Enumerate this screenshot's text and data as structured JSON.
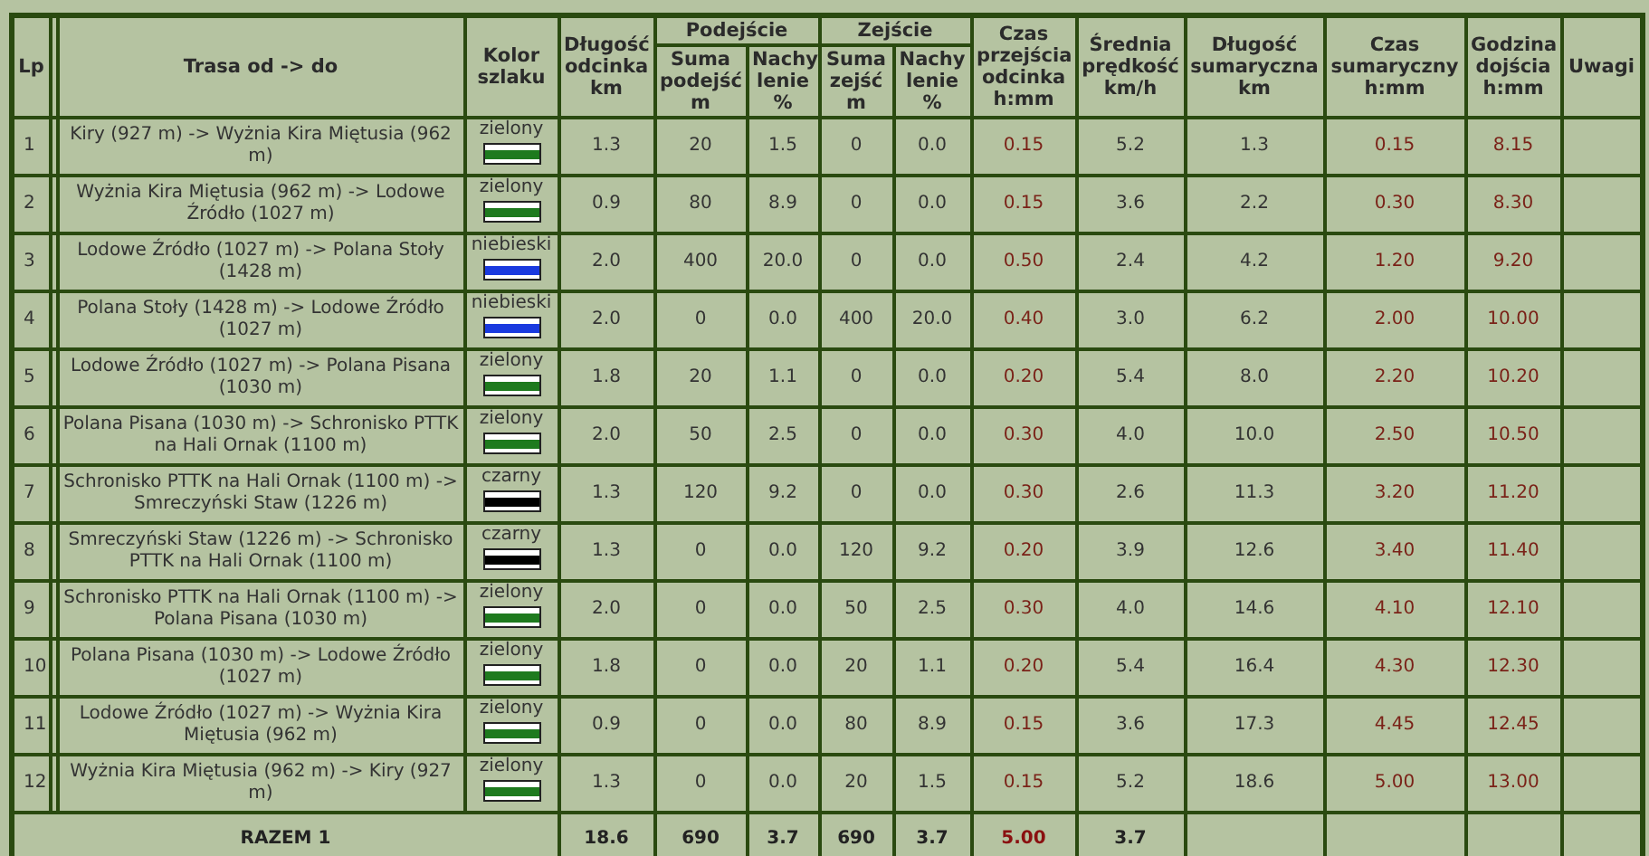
{
  "table": {
    "columns": {
      "lp": "Lp",
      "route": "Trasa od -> do",
      "trail": "Kolor szlaku",
      "length": "Długość odcinka km",
      "ascent": "Podejście",
      "ascent_sum": "Suma podejść m",
      "ascent_grade": "Nachy lenie %",
      "descent": "Zejście",
      "descent_sum": "Suma zejść m",
      "descent_grade": "Nachy lenie %",
      "time": "Czas przejścia odcinka h:mm",
      "speed": "Średnia prędkość km/h",
      "total_length": "Długość sumaryczna km",
      "total_time": "Czas sumaryczny h:mm",
      "arrival": "Godzina dojścia h:mm",
      "notes": "Uwagi"
    },
    "rows": [
      {
        "lp": "1",
        "route": "Kiry (927 m) -> Wyżnia Kira Miętusia (962 m)",
        "trail": "zielony",
        "color": "#1e7a1e",
        "length": "1.3",
        "ascent_sum": "20",
        "ascent_grade": "1.5",
        "descent_sum": "0",
        "descent_grade": "0.0",
        "time": "0.15",
        "speed": "5.2",
        "total_length": "1.3",
        "total_time": "0.15",
        "arrival": "8.15"
      },
      {
        "lp": "2",
        "route": "Wyżnia Kira Miętusia (962 m) -> Lodowe Źródło (1027 m)",
        "trail": "zielony",
        "color": "#1e7a1e",
        "length": "0.9",
        "ascent_sum": "80",
        "ascent_grade": "8.9",
        "descent_sum": "0",
        "descent_grade": "0.0",
        "time": "0.15",
        "speed": "3.6",
        "total_length": "2.2",
        "total_time": "0.30",
        "arrival": "8.30"
      },
      {
        "lp": "3",
        "route": "Lodowe Źródło (1027 m) -> Polana Stoły (1428 m)",
        "trail": "niebieski",
        "color": "#1a3adf",
        "length": "2.0",
        "ascent_sum": "400",
        "ascent_grade": "20.0",
        "descent_sum": "0",
        "descent_grade": "0.0",
        "time": "0.50",
        "speed": "2.4",
        "total_length": "4.2",
        "total_time": "1.20",
        "arrival": "9.20"
      },
      {
        "lp": "4",
        "route": "Polana Stoły (1428 m) -> Lodowe Źródło (1027 m)",
        "trail": "niebieski",
        "color": "#1a3adf",
        "length": "2.0",
        "ascent_sum": "0",
        "ascent_grade": "0.0",
        "descent_sum": "400",
        "descent_grade": "20.0",
        "time": "0.40",
        "speed": "3.0",
        "total_length": "6.2",
        "total_time": "2.00",
        "arrival": "10.00"
      },
      {
        "lp": "5",
        "route": "Lodowe Źródło (1027 m) -> Polana Pisana (1030 m)",
        "trail": "zielony",
        "color": "#1e7a1e",
        "length": "1.8",
        "ascent_sum": "20",
        "ascent_grade": "1.1",
        "descent_sum": "0",
        "descent_grade": "0.0",
        "time": "0.20",
        "speed": "5.4",
        "total_length": "8.0",
        "total_time": "2.20",
        "arrival": "10.20"
      },
      {
        "lp": "6",
        "route": "Polana Pisana (1030 m) -> Schronisko PTTK na Hali Ornak (1100 m)",
        "trail": "zielony",
        "color": "#1e7a1e",
        "length": "2.0",
        "ascent_sum": "50",
        "ascent_grade": "2.5",
        "descent_sum": "0",
        "descent_grade": "0.0",
        "time": "0.30",
        "speed": "4.0",
        "total_length": "10.0",
        "total_time": "2.50",
        "arrival": "10.50"
      },
      {
        "lp": "7",
        "route": "Schronisko PTTK na Hali Ornak (1100 m) -> Smreczyński Staw (1226 m)",
        "trail": "czarny",
        "color": "#000000",
        "length": "1.3",
        "ascent_sum": "120",
        "ascent_grade": "9.2",
        "descent_sum": "0",
        "descent_grade": "0.0",
        "time": "0.30",
        "speed": "2.6",
        "total_length": "11.3",
        "total_time": "3.20",
        "arrival": "11.20"
      },
      {
        "lp": "8",
        "route": "Smreczyński Staw (1226 m) -> Schronisko PTTK na Hali Ornak (1100 m)",
        "trail": "czarny",
        "color": "#000000",
        "length": "1.3",
        "ascent_sum": "0",
        "ascent_grade": "0.0",
        "descent_sum": "120",
        "descent_grade": "9.2",
        "time": "0.20",
        "speed": "3.9",
        "total_length": "12.6",
        "total_time": "3.40",
        "arrival": "11.40"
      },
      {
        "lp": "9",
        "route": "Schronisko PTTK na Hali Ornak (1100 m) -> Polana Pisana (1030 m)",
        "trail": "zielony",
        "color": "#1e7a1e",
        "length": "2.0",
        "ascent_sum": "0",
        "ascent_grade": "0.0",
        "descent_sum": "50",
        "descent_grade": "2.5",
        "time": "0.30",
        "speed": "4.0",
        "total_length": "14.6",
        "total_time": "4.10",
        "arrival": "12.10"
      },
      {
        "lp": "10",
        "route": "Polana Pisana (1030 m) -> Lodowe Źródło (1027 m)",
        "trail": "zielony",
        "color": "#1e7a1e",
        "length": "1.8",
        "ascent_sum": "0",
        "ascent_grade": "0.0",
        "descent_sum": "20",
        "descent_grade": "1.1",
        "time": "0.20",
        "speed": "5.4",
        "total_length": "16.4",
        "total_time": "4.30",
        "arrival": "12.30"
      },
      {
        "lp": "11",
        "route": "Lodowe Źródło (1027 m) -> Wyżnia Kira Miętusia (962 m)",
        "trail": "zielony",
        "color": "#1e7a1e",
        "length": "0.9",
        "ascent_sum": "0",
        "ascent_grade": "0.0",
        "descent_sum": "80",
        "descent_grade": "8.9",
        "time": "0.15",
        "speed": "3.6",
        "total_length": "17.3",
        "total_time": "4.45",
        "arrival": "12.45"
      },
      {
        "lp": "12",
        "route": "Wyżnia Kira Miętusia (962 m) -> Kiry (927 m)",
        "trail": "zielony",
        "color": "#1e7a1e",
        "length": "1.3",
        "ascent_sum": "0",
        "ascent_grade": "0.0",
        "descent_sum": "20",
        "descent_grade": "1.5",
        "time": "0.15",
        "speed": "5.2",
        "total_length": "18.6",
        "total_time": "5.00",
        "arrival": "13.00"
      }
    ],
    "total": {
      "label": "RAZEM 1",
      "length": "18.6",
      "ascent_sum": "690",
      "ascent_grade": "3.7",
      "descent_sum": "690",
      "descent_grade": "3.7",
      "time": "5.00",
      "speed": "3.7"
    }
  }
}
